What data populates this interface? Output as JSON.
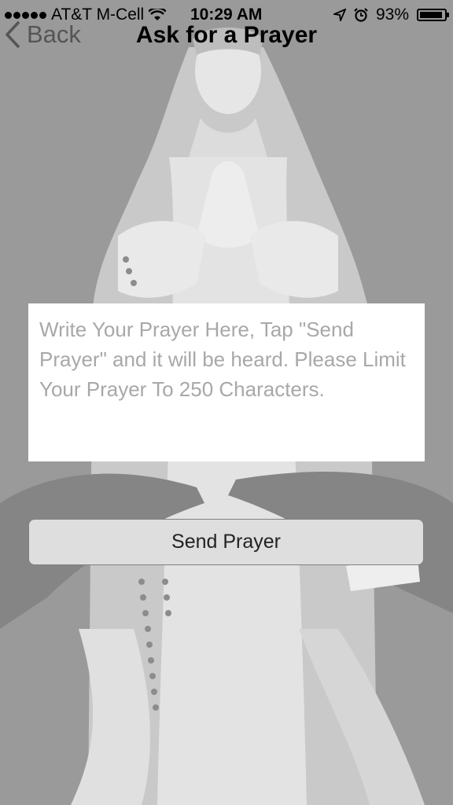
{
  "status_bar": {
    "carrier": "AT&T M-Cell",
    "time": "10:29 AM",
    "battery": "93%",
    "battery_level": 0.93,
    "icons": [
      "signal-dots-icon",
      "wifi-icon",
      "location-arrow-icon",
      "alarm-clock-icon",
      "battery-icon"
    ]
  },
  "nav": {
    "back_label": "Back",
    "title": "Ask for a Prayer"
  },
  "prayer_input": {
    "value": "",
    "placeholder": "Write Your Prayer Here, Tap \"Send Prayer\" and it will be heard. Please Limit Your Prayer To 250 Characters."
  },
  "send_button": {
    "label": "Send Prayer"
  },
  "colors": {
    "background": "#9a9a9a",
    "statue": "#dcdcdc",
    "button_fill": "#dedede",
    "button_border": "#808080",
    "back_text": "#555555",
    "placeholder_text": "#a8a8a8"
  }
}
